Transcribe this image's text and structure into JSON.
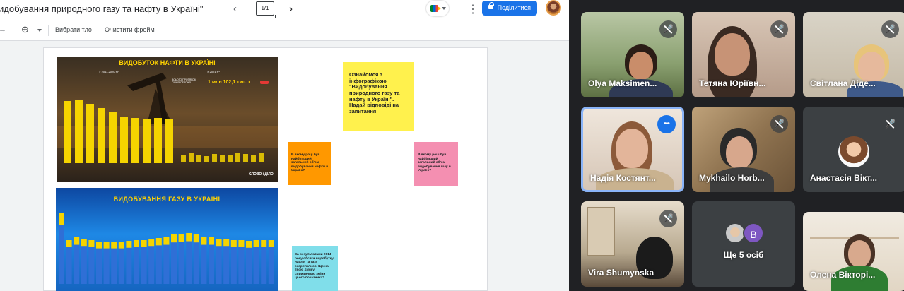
{
  "jamboard": {
    "title": "идобування природного газу та нафту в Україні\"",
    "frame_counter": "1/1",
    "prev_icon": "chevron-left-icon",
    "next_icon": "chevron-right-icon",
    "share_label": "Поділитися",
    "toolbar": {
      "set_background_label": "Вибрати тло",
      "clear_frame_label": "Очистити фрейм",
      "zoom_icon": "zoom-in-icon"
    },
    "oil_infographic": {
      "title": "ВИДОБУТОК НАФТИ В УКРАЇНІ",
      "subtitle_left": "У 2011-2020 РР",
      "subtitle_right": "У 2021 Р*",
      "total_label": "ВСЬОГО ПРОТЯГОМ СІЧНЯ-СЕРПНЯ",
      "total_value": "1 млн 102,1 тис. т",
      "logo": "СЛОВО і ДІЛО"
    },
    "gas_infographic": {
      "title": "ВИДОБУВАННЯ ГАЗУ В УКРАЇНІ"
    },
    "stickies": {
      "main": "Ознайомся з інфографікою \"Видобування природного газу та нафту в Україні\". Надай відповіді на запитання",
      "oil_question": "В якому році був найбільший загальний об'єм видобування нафти в Україні?",
      "gas_question": "В якому році був найбільший загальний об'єм видобування газу в Україні?",
      "year_2014": "За результатами 2014 року обсяги видобутку нафти та газу скоротилися. Що на твою думку спричинило зміни цього показника?"
    },
    "colors": {
      "share": "#1a73e8",
      "sticky_yellow": "#fff14d",
      "sticky_orange": "#ff9800",
      "sticky_pink": "#f48fb1",
      "sticky_cyan": "#80deea"
    }
  },
  "meet": {
    "participants": [
      {
        "name": "Olya Maksimen...",
        "muted": true
      },
      {
        "name": "Тетяна Юріївн...",
        "muted": true
      },
      {
        "name": "Світлана Діде...",
        "muted": true
      },
      {
        "name": "Надія Костянт...",
        "muted": false,
        "speaking": true
      },
      {
        "name": "Mykhailo Horb...",
        "muted": true
      },
      {
        "name": "Анастасія Вікт...",
        "muted": true
      },
      {
        "name": "Vira Shumynska",
        "muted": true
      },
      {
        "name": "Ще 5 осіб",
        "avatar_letter": "B"
      },
      {
        "name": "Олена Вікторі...",
        "muted": false
      }
    ],
    "colors": {
      "speaking_border": "#8ab4f8",
      "avatar_b": "#7e57c2"
    }
  }
}
